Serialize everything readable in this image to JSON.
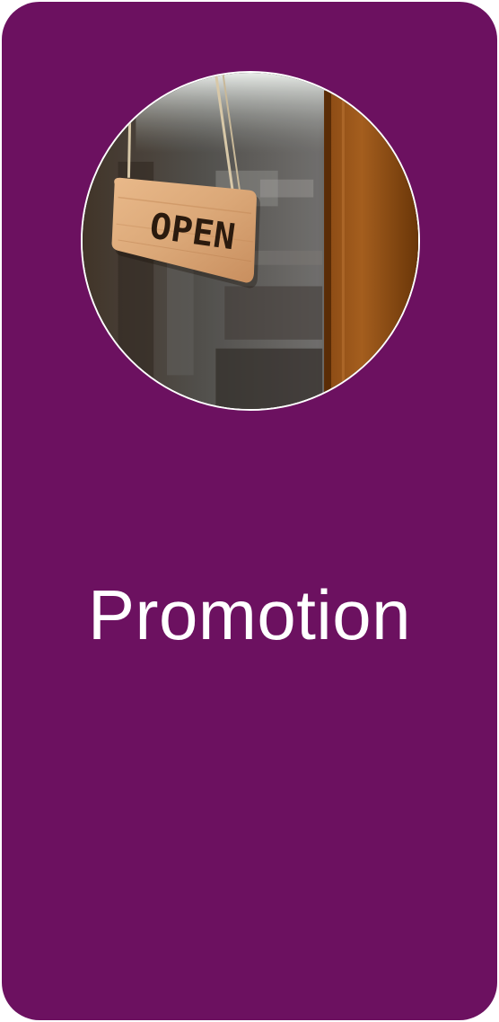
{
  "card": {
    "title": "Promotion",
    "background_color": "#6c1160",
    "text_color": "#ffffff"
  },
  "photo": {
    "sign_text": "OPEN",
    "subject": "wooden-open-sign-image"
  }
}
